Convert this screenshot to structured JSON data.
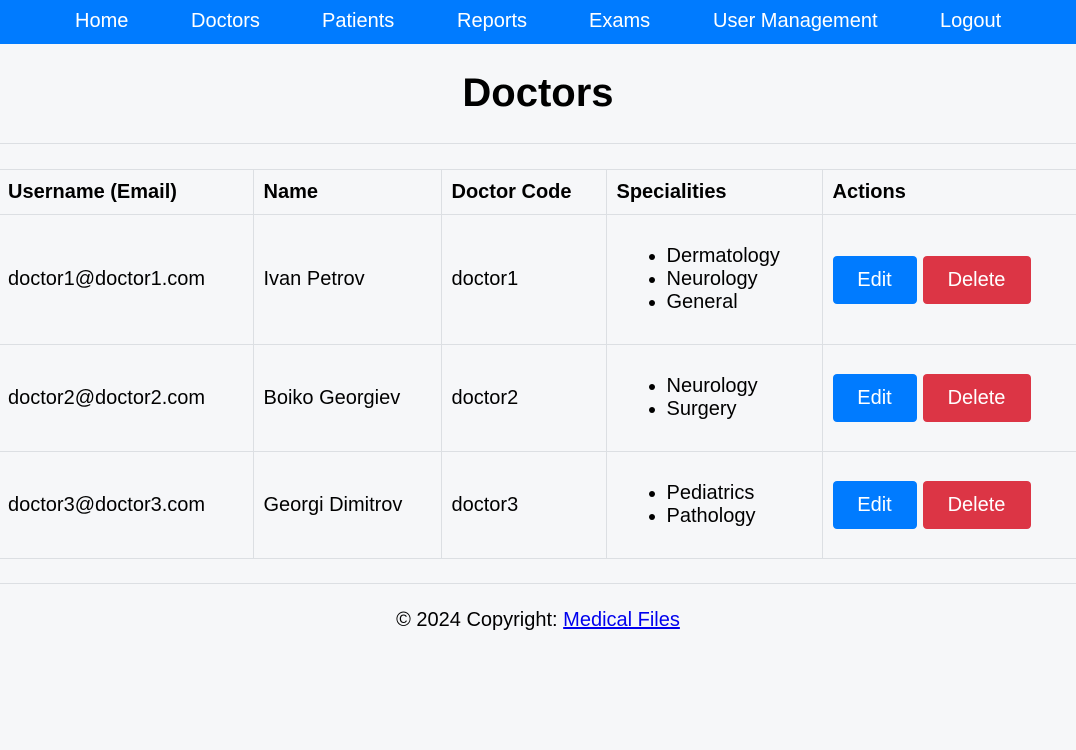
{
  "nav": {
    "items": [
      {
        "label": "Home"
      },
      {
        "label": "Doctors"
      },
      {
        "label": "Patients"
      },
      {
        "label": "Reports"
      },
      {
        "label": "Exams"
      },
      {
        "label": "User Management"
      },
      {
        "label": "Logout"
      }
    ],
    "background": "#007bff"
  },
  "page": {
    "title": "Doctors"
  },
  "table": {
    "headers": [
      "Username (Email)",
      "Name",
      "Doctor Code",
      "Specialities",
      "Actions"
    ],
    "rows": [
      {
        "email": "doctor1@doctor1.com",
        "name": "Ivan Petrov",
        "code": "doctor1",
        "specialities": [
          "Dermatology",
          "Neurology",
          "General"
        ],
        "edit_label": "Edit",
        "delete_label": "Delete"
      },
      {
        "email": "doctor2@doctor2.com",
        "name": "Boiko Georgiev",
        "code": "doctor2",
        "specialities": [
          "Neurology",
          "Surgery"
        ],
        "edit_label": "Edit",
        "delete_label": "Delete"
      },
      {
        "email": "doctor3@doctor3.com",
        "name": "Georgi Dimitrov",
        "code": "doctor3",
        "specialities": [
          "Pediatrics",
          "Pathology"
        ],
        "edit_label": "Edit",
        "delete_label": "Delete"
      }
    ]
  },
  "footer": {
    "text": "© 2024 Copyright: ",
    "link_label": "Medical Files"
  },
  "colors": {
    "primary": "#007bff",
    "danger": "#dc3545",
    "background": "#f6f7f9"
  }
}
